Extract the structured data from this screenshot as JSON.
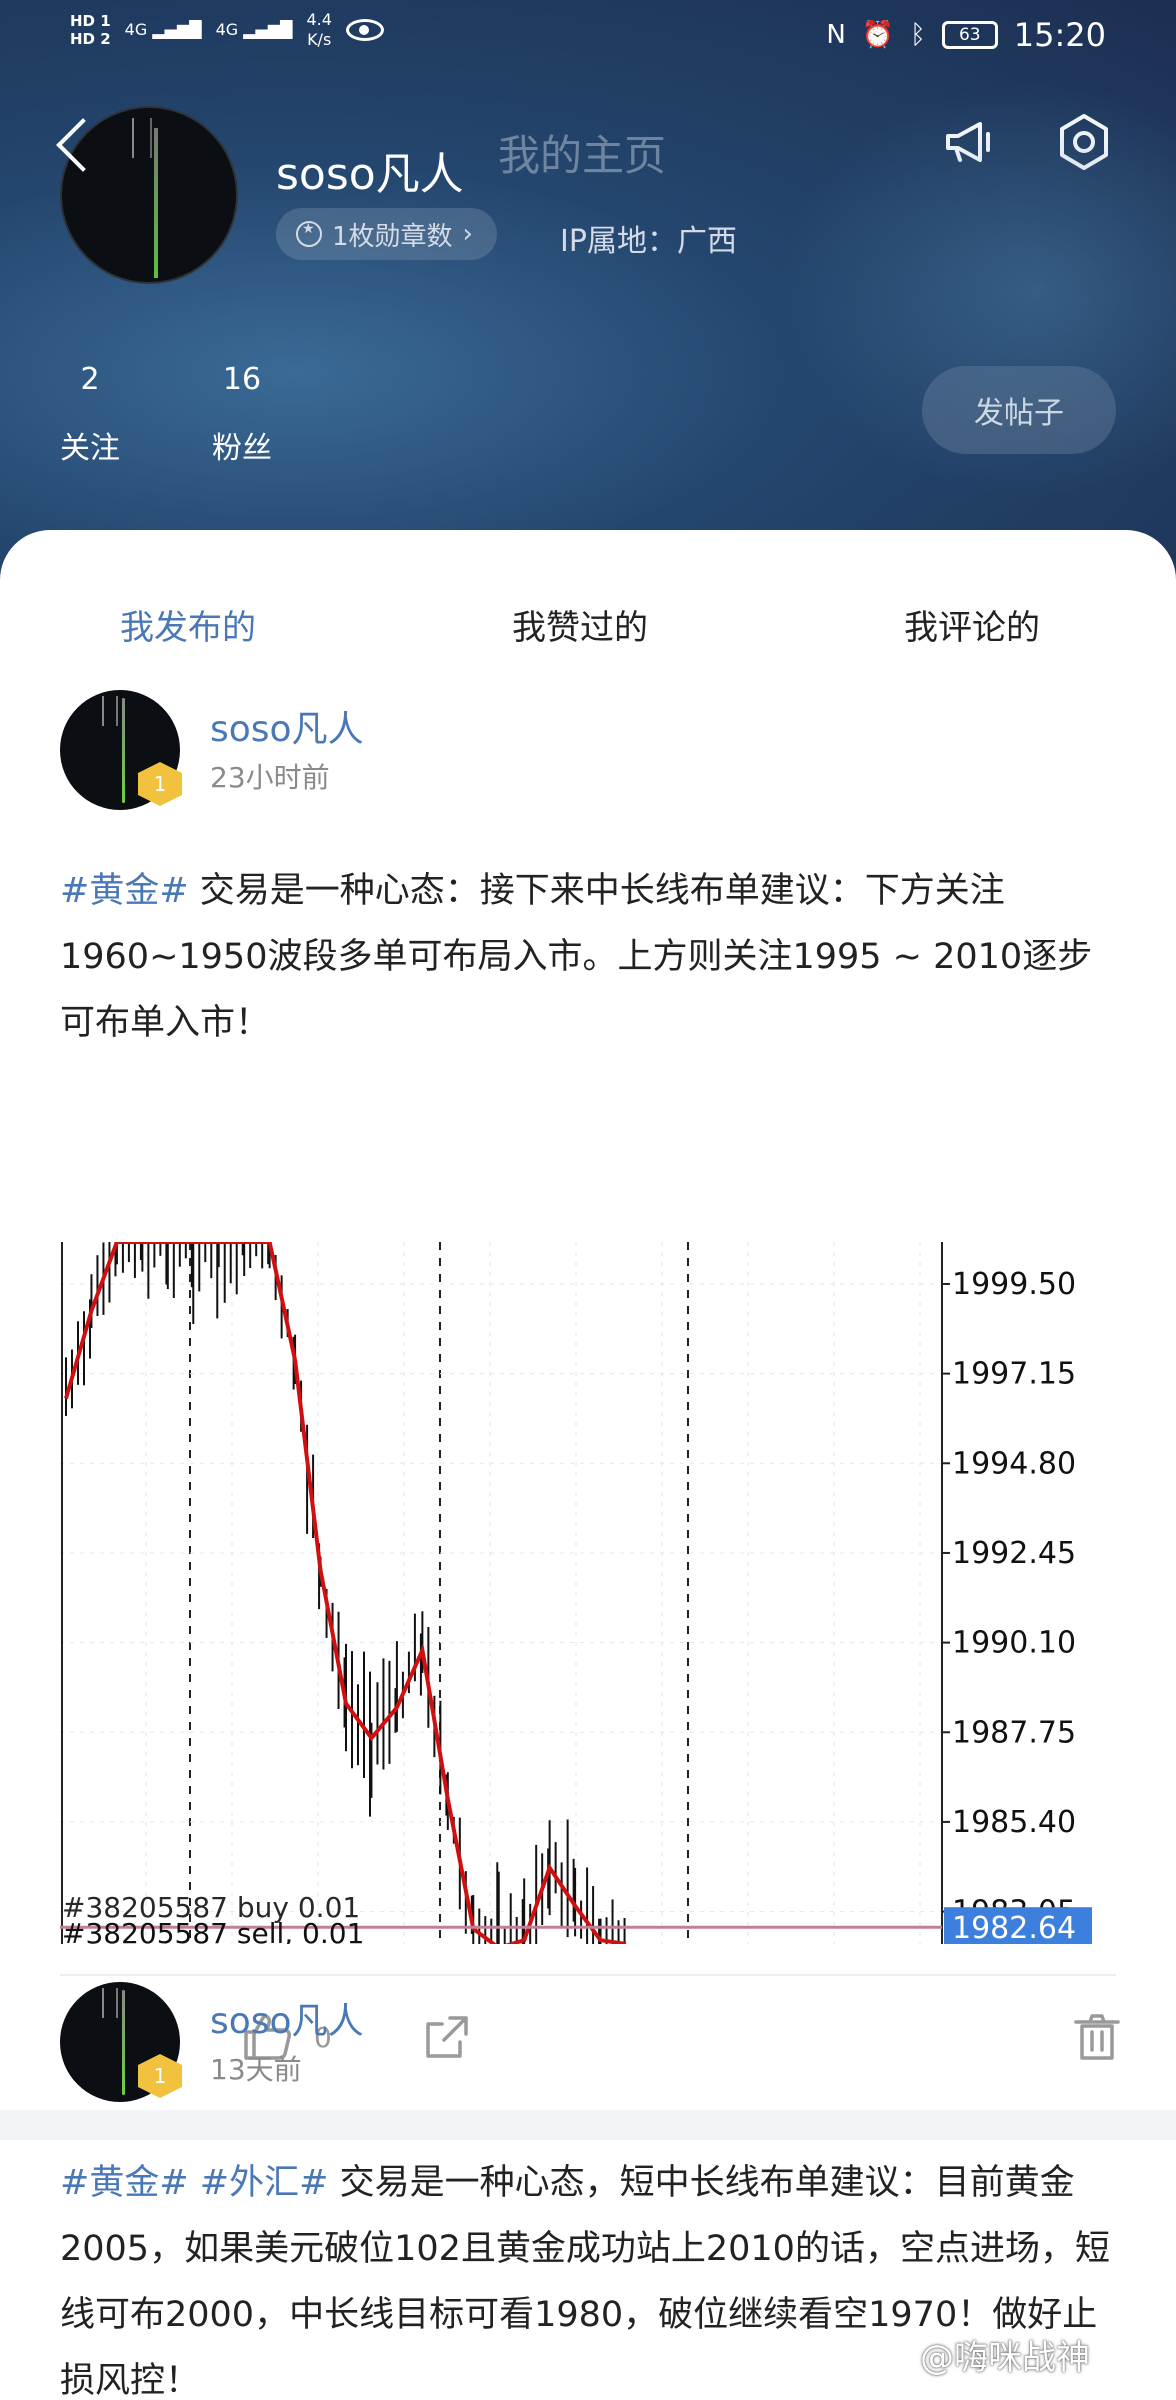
{
  "status_bar": {
    "hd1": "HD 1",
    "hd2": "HD 2",
    "net1": "4G",
    "net2": "4G",
    "speed": "4.4",
    "speed_unit": "K/s",
    "battery": "63",
    "time": "15:20"
  },
  "header": {
    "username": "soso凡人",
    "subtitle": "我的主页",
    "badge_count": "1枚勋章数",
    "ip_location": "IP属地：广西",
    "stats": [
      {
        "count": "2",
        "label": "关注"
      },
      {
        "count": "16",
        "label": "粉丝"
      }
    ],
    "post_button": "发帖子"
  },
  "tabs": [
    "我发布的",
    "我赞过的",
    "我评论的"
  ],
  "active_tab": 0,
  "posts": [
    {
      "author": "soso凡人",
      "level": "1",
      "time": "23小时前",
      "tags": [
        "#黄金#"
      ],
      "body": "交易是一种心态：接下来中长线布单建议：下方关注1960~1950波段多单可布局入市。上方则关注1995 ~ 2010逐步可布单入市！",
      "comments": "0",
      "likes": "0"
    },
    {
      "author": "soso凡人",
      "level": "1",
      "time": "13天前",
      "tags": [
        "#黄金#",
        "#外汇#"
      ],
      "body": "交易是一种心态，短中长线布单建议：目前黄金2005，如果美元破位102且黄金成功站上2010的话，空点进场，短线可布2000，中长线目标可看1980，破位继续看空1970！做好止损风控！"
    }
  ],
  "chart_data": {
    "type": "line",
    "price_ticks": [
      "1999.50",
      "1997.15",
      "1994.80",
      "1992.45",
      "1990.10",
      "1987.75",
      "1985.40",
      "1983.05"
    ],
    "ylim": [
      1982.2,
      2000.6
    ],
    "current_price": "1982.64",
    "order_label": "#38205587 sell, 0.01",
    "order_label_overlay": "#38205587 buy 0.01",
    "series": [
      {
        "values": [
          1996.5,
          1998.8,
          2000.6,
          2000.6,
          2000.6,
          2000.6,
          2000.6,
          2000.6,
          2000.6,
          1997.5,
          1992.0,
          1988.5,
          1987.6,
          1988.4,
          1989.9,
          1986.0,
          1982.6,
          1982.1,
          1982.3,
          1984.2,
          1983.2,
          1982.3,
          1982.2
        ]
      }
    ],
    "colors": {
      "ma_line": "#d01010",
      "price_line": "#c08098",
      "current_price_bg": "#3d7fdc",
      "sl_line": "#2a9a2a"
    }
  },
  "watermark": "@嗨咪战神",
  "colors": {
    "accent": "#4a78b6",
    "badge": "#f2c23e"
  }
}
